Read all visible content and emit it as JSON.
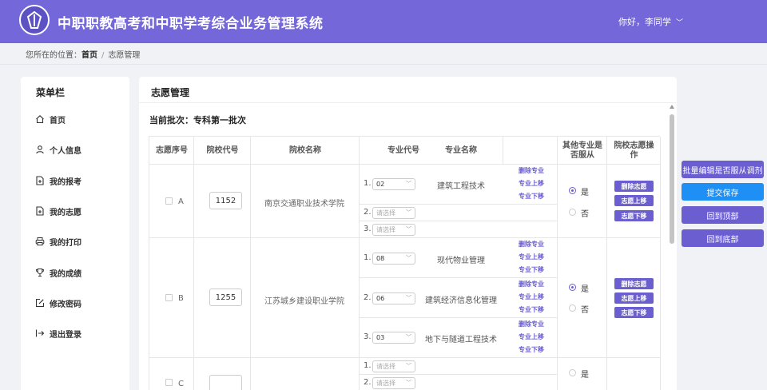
{
  "header": {
    "title": "中职职教高考和中职学考综合业务管理系统",
    "user": "你好，李同学"
  },
  "breadcrumb": {
    "prefix": "您所在的位置：",
    "home": "首页",
    "separator": "/",
    "current": "志愿管理"
  },
  "sidebar": {
    "title": "菜单栏",
    "items": [
      {
        "label": "首页",
        "icon": "home-icon"
      },
      {
        "label": "个人信息",
        "icon": "user-icon"
      },
      {
        "label": "我的报考",
        "icon": "file-plus-icon"
      },
      {
        "label": "我的志愿",
        "icon": "file-plus-icon"
      },
      {
        "label": "我的打印",
        "icon": "printer-icon"
      },
      {
        "label": "我的成绩",
        "icon": "trophy-icon"
      },
      {
        "label": "修改密码",
        "icon": "edit-icon"
      },
      {
        "label": "退出登录",
        "icon": "logout-icon"
      }
    ]
  },
  "main": {
    "title": "志愿管理",
    "batch": "当前批次：专科第一批次",
    "columns": [
      "志愿序号",
      "院校代号",
      "院校名称",
      "专业代号",
      "专业名称",
      "",
      "其他专业是否服从",
      "院校志愿操作"
    ],
    "placeholder": "请选择",
    "major_actions": [
      "删除专业",
      "专业上移",
      "专业下移"
    ],
    "school_actions": [
      "删除志愿",
      "志愿上移",
      "志愿下移"
    ],
    "radio_yes": "是",
    "radio_no": "否",
    "rows": [
      {
        "letter": "A",
        "code": "1152",
        "school": "南京交通职业技术学院",
        "obey": "是",
        "majors": [
          {
            "num": "1.",
            "code": "02",
            "name": "建筑工程技术"
          },
          {
            "num": "2.",
            "code": "",
            "name": ""
          },
          {
            "num": "3.",
            "code": "",
            "name": ""
          }
        ]
      },
      {
        "letter": "B",
        "code": "1255",
        "school": "江苏城乡建设职业学院",
        "obey": "是",
        "majors": [
          {
            "num": "1.",
            "code": "08",
            "name": "现代物业管理"
          },
          {
            "num": "2.",
            "code": "06",
            "name": "建筑经济信息化管理"
          },
          {
            "num": "3.",
            "code": "03",
            "name": "地下与隧道工程技术"
          }
        ]
      },
      {
        "letter": "C",
        "code": "",
        "school": "",
        "obey": "",
        "majors": [
          {
            "num": "1.",
            "code": "",
            "name": ""
          },
          {
            "num": "2.",
            "code": "",
            "name": ""
          }
        ]
      }
    ]
  },
  "right_buttons": [
    "批量编辑是否服从调剂",
    "提交保存",
    "回到顶部",
    "回到底部"
  ],
  "colors": {
    "primary": "#7367d9",
    "action": "#6a5ed0",
    "save": "#1e8ff5"
  }
}
